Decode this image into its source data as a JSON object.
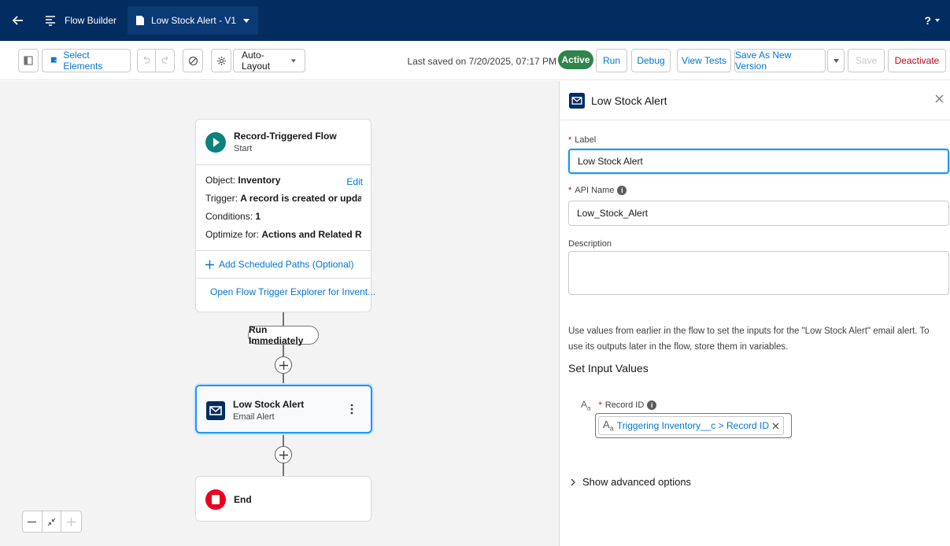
{
  "header": {
    "app_name": "Flow Builder",
    "flow_tab_label": "Low Stock Alert - V1",
    "help_label": "?"
  },
  "toolbar": {
    "select_elements_label": "Select Elements",
    "layout_value": "Auto-Layout",
    "last_saved": "Last saved on 7/20/2025, 07:17 PM",
    "status_badge": "Active",
    "run_label": "Run",
    "debug_label": "Debug",
    "view_tests_label": "View Tests",
    "save_as_new_version_label": "Save As New Version",
    "save_label": "Save",
    "deactivate_label": "Deactivate"
  },
  "canvas": {
    "start": {
      "title": "Record-Triggered Flow",
      "subtitle": "Start",
      "edit_label": "Edit",
      "object_label": "Object: ",
      "object_value": "Inventory",
      "trigger_label": "Trigger: ",
      "trigger_value": "A record is created or updated",
      "conditions_label": "Conditions: ",
      "conditions_value": "1",
      "optimize_label": "Optimize for: ",
      "optimize_value": "Actions and Related Recor...",
      "add_paths_label": "Add Scheduled Paths (Optional)",
      "explorer_label": "Open Flow Trigger Explorer for Invent..."
    },
    "run_immediately_label": "Run Immediately",
    "action": {
      "title": "Low Stock Alert",
      "subtitle": "Email Alert"
    },
    "end": {
      "title": "End"
    }
  },
  "panel": {
    "title": "Low Stock Alert",
    "label_field": {
      "label": "Label",
      "value": "Low Stock Alert"
    },
    "api_name_field": {
      "label": "API Name",
      "value": "Low_Stock_Alert"
    },
    "description_field": {
      "label": "Description",
      "value": ""
    },
    "help_text": "Use values from earlier in the flow to set the inputs for the \"Low Stock Alert\" email alert. To use its outputs later in the flow, store them in variables.",
    "set_input_title": "Set Input Values",
    "record_id_label": "Record ID",
    "record_id_token": "Triggering Inventory__c > Record ID",
    "advanced_label": "Show advanced options"
  },
  "colors": {
    "header_bg": "#032d60",
    "brand_blue": "#0176d3",
    "active_green": "#2e844a",
    "start_teal": "#0b827c",
    "action_navy": "#032d60",
    "end_red": "#ea001e",
    "danger_red": "#ba0517"
  }
}
